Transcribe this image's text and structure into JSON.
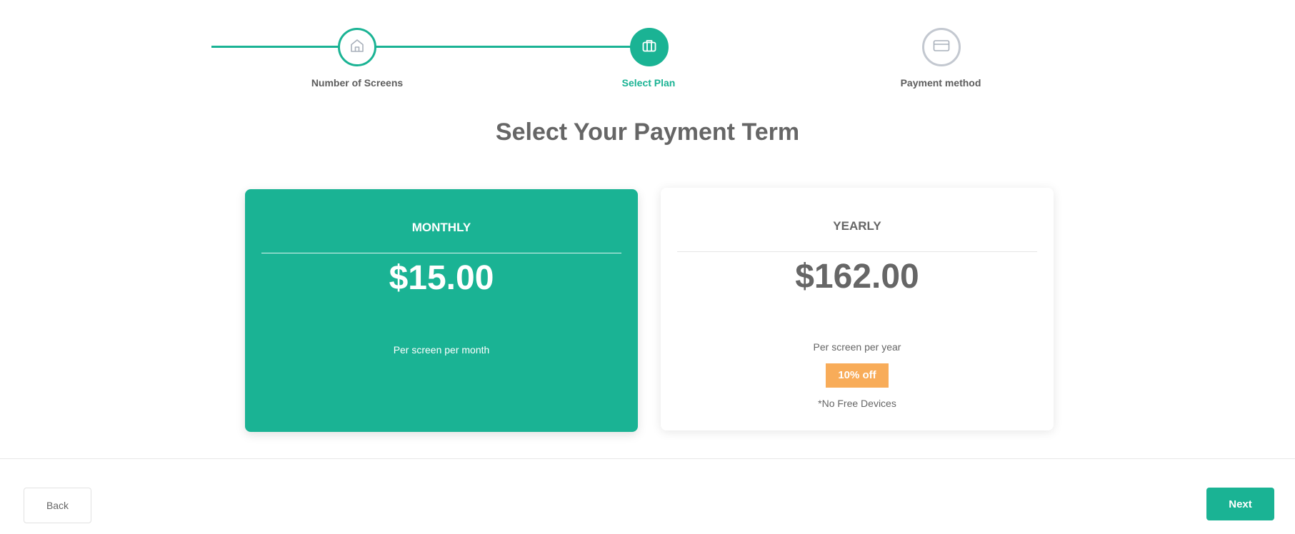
{
  "stepper": {
    "steps": [
      {
        "label": "Number of Screens",
        "icon": "home-icon",
        "state": "completed"
      },
      {
        "label": "Select Plan",
        "icon": "briefcase-icon",
        "state": "active"
      },
      {
        "label": "Payment method",
        "icon": "credit-card-icon",
        "state": "pending"
      }
    ]
  },
  "page": {
    "title": "Select Your Payment Term"
  },
  "plans": {
    "monthly": {
      "term": "MONTHLY",
      "price": "$15.00",
      "period": "Per screen per month"
    },
    "yearly": {
      "term": "YEARLY",
      "price": "$162.00",
      "period": "Per screen per year",
      "badge": "10% off",
      "note": "*No Free Devices"
    }
  },
  "footer": {
    "back_label": "Back",
    "next_label": "Next"
  },
  "colors": {
    "accent": "#1ab394",
    "badge": "#f8ac59",
    "text": "#666666",
    "inactive": "#c3c8d0"
  }
}
